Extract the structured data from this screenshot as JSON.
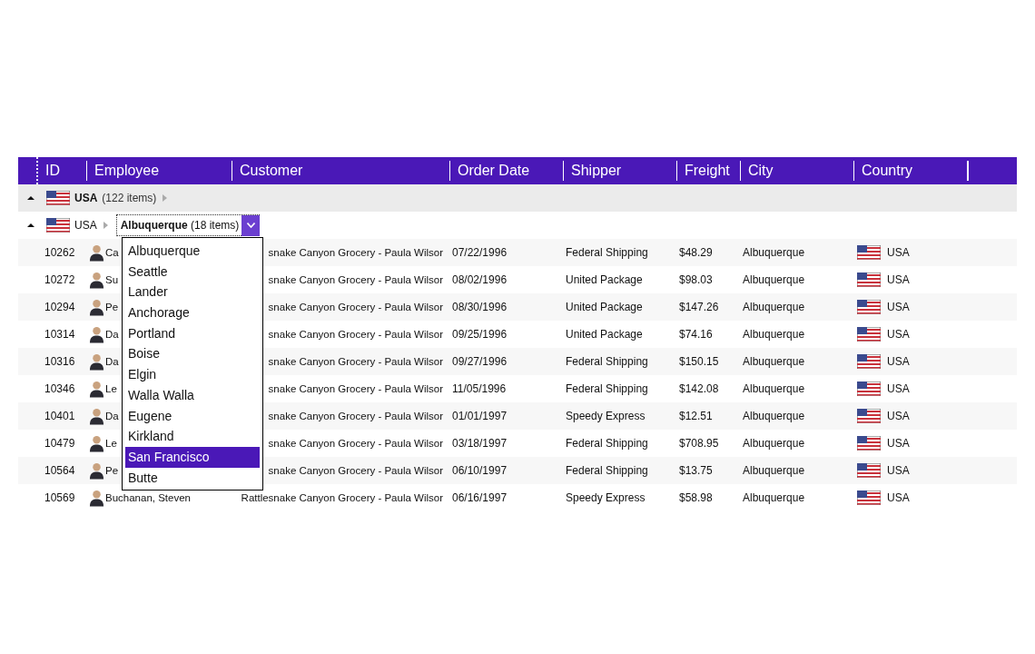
{
  "columns": [
    "ID",
    "Employee",
    "Customer",
    "Order Date",
    "Shipper",
    "Freight",
    "City",
    "Country"
  ],
  "group": {
    "label": "USA",
    "count": "(122 items)",
    "expanded": true
  },
  "subgroup": {
    "country": "USA",
    "city": "Albuquerque",
    "count": "(18 items)",
    "expanded": true
  },
  "rows": [
    {
      "id": "10262",
      "employee": "Ca",
      "customer": "snake Canyon Grocery - Paula Wilsor",
      "date": "07/22/1996",
      "shipper": "Federal Shipping",
      "freight": "$48.29",
      "city": "Albuquerque",
      "country": "USA"
    },
    {
      "id": "10272",
      "employee": "Su",
      "customer": "snake Canyon Grocery - Paula Wilsor",
      "date": "08/02/1996",
      "shipper": "United Package",
      "freight": "$98.03",
      "city": "Albuquerque",
      "country": "USA"
    },
    {
      "id": "10294",
      "employee": "Pe",
      "customer": "snake Canyon Grocery - Paula Wilsor",
      "date": "08/30/1996",
      "shipper": "United Package",
      "freight": "$147.26",
      "city": "Albuquerque",
      "country": "USA"
    },
    {
      "id": "10314",
      "employee": "Da",
      "customer": "snake Canyon Grocery - Paula Wilsor",
      "date": "09/25/1996",
      "shipper": "United Package",
      "freight": "$74.16",
      "city": "Albuquerque",
      "country": "USA"
    },
    {
      "id": "10316",
      "employee": "Da",
      "customer": "snake Canyon Grocery - Paula Wilsor",
      "date": "09/27/1996",
      "shipper": "Federal Shipping",
      "freight": "$150.15",
      "city": "Albuquerque",
      "country": "USA"
    },
    {
      "id": "10346",
      "employee": "Le",
      "customer": "snake Canyon Grocery - Paula Wilsor",
      "date": "11/05/1996",
      "shipper": "Federal Shipping",
      "freight": "$142.08",
      "city": "Albuquerque",
      "country": "USA"
    },
    {
      "id": "10401",
      "employee": "Da",
      "customer": "snake Canyon Grocery - Paula Wilsor",
      "date": "01/01/1997",
      "shipper": "Speedy Express",
      "freight": "$12.51",
      "city": "Albuquerque",
      "country": "USA"
    },
    {
      "id": "10479",
      "employee": "Le",
      "customer": "snake Canyon Grocery - Paula Wilsor",
      "date": "03/18/1997",
      "shipper": "Federal Shipping",
      "freight": "$708.95",
      "city": "Albuquerque",
      "country": "USA"
    },
    {
      "id": "10564",
      "employee": "Pe",
      "customer": "snake Canyon Grocery - Paula Wilsor",
      "date": "06/10/1997",
      "shipper": "Federal Shipping",
      "freight": "$13.75",
      "city": "Albuquerque",
      "country": "USA"
    },
    {
      "id": "10569",
      "employee": "Buchanan, Steven",
      "customer": "Rattlesnake Canyon Grocery - Paula Wilsor",
      "date": "06/16/1997",
      "shipper": "Speedy Express",
      "freight": "$58.98",
      "city": "Albuquerque",
      "country": "USA"
    }
  ],
  "dropdown": {
    "items": [
      {
        "label": "Albuquerque",
        "selected": false
      },
      {
        "label": "Seattle",
        "selected": false
      },
      {
        "label": "Lander",
        "selected": false
      },
      {
        "label": "Anchorage",
        "selected": false
      },
      {
        "label": "Portland",
        "selected": false
      },
      {
        "label": "Boise",
        "selected": false
      },
      {
        "label": "Elgin",
        "selected": false
      },
      {
        "label": "Walla Walla",
        "selected": false
      },
      {
        "label": "Eugene",
        "selected": false
      },
      {
        "label": "Kirkland",
        "selected": false
      },
      {
        "label": "San Francisco",
        "selected": true
      },
      {
        "label": "Butte",
        "selected": false
      }
    ]
  }
}
